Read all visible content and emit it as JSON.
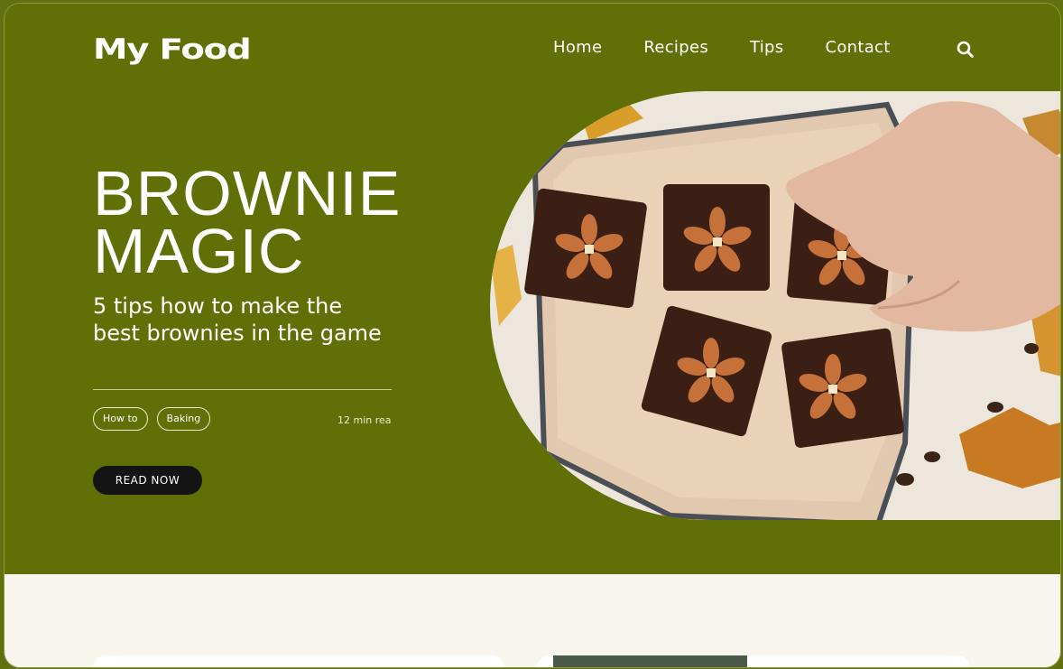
{
  "header": {
    "logo": "My Food",
    "nav": [
      "Home",
      "Recipes",
      "Tips",
      "Contact"
    ],
    "search_icon": "search-icon"
  },
  "hero": {
    "title_line1": "BROWNIE",
    "title_line2": "MAGIC",
    "subtitle": "5 tips how to make the best brownies in the game",
    "tags": [
      "How to",
      "Baking"
    ],
    "read_time": "12 min rea",
    "cta_label": "READ NOW",
    "image": "brownies-with-almonds-on-plate"
  },
  "colors": {
    "hero_bg": "#607006",
    "lower_bg": "#f8f6ec",
    "button_bg": "#141414"
  }
}
